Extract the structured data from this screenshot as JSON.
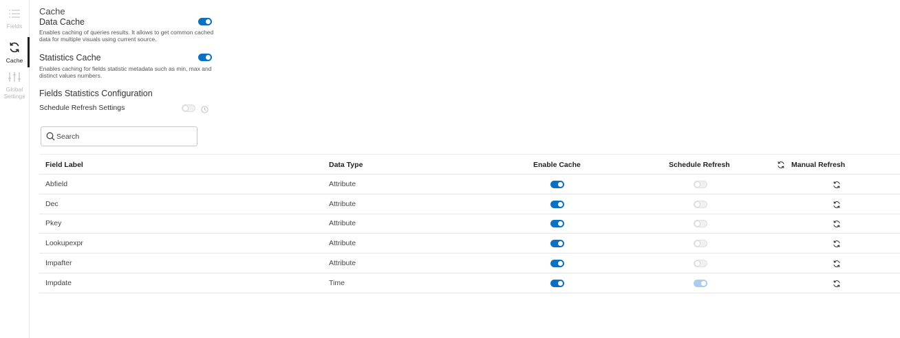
{
  "sidebar": {
    "items": [
      {
        "label": "Fields",
        "icon": "list-icon",
        "active": false
      },
      {
        "label": "Cache",
        "icon": "refresh-icon",
        "active": true
      },
      {
        "label": "Global Settings",
        "label_line1": "Global",
        "label_line2": "Settings",
        "icon": "sliders-icon",
        "active": false
      }
    ]
  },
  "cache": {
    "title": "Cache",
    "data_cache": {
      "title": "Data Cache",
      "description": "Enables caching of queries results. It allows to get common cached data for multiple visuals using current source.",
      "enabled": true
    },
    "statistics_cache": {
      "title": "Statistics Cache",
      "description": "Enables caching for fields statistic metadata such as min, max and distinct values numbers.",
      "enabled": true
    },
    "fields_stats": {
      "title": "Fields Statistics Configuration",
      "schedule_label": "Schedule Refresh Settings",
      "schedule_enabled": false
    }
  },
  "search": {
    "placeholder": "Search",
    "value": ""
  },
  "table": {
    "columns": {
      "field_label": "Field Label",
      "data_type": "Data Type",
      "enable_cache": "Enable Cache",
      "schedule_refresh": "Schedule Refresh",
      "manual_refresh": "Manual Refresh"
    },
    "rows": [
      {
        "label": "Abfield",
        "type": "Attribute",
        "enable_cache": true,
        "schedule_refresh": false
      },
      {
        "label": "Dec",
        "type": "Attribute",
        "enable_cache": true,
        "schedule_refresh": false
      },
      {
        "label": "Pkey",
        "type": "Attribute",
        "enable_cache": true,
        "schedule_refresh": false
      },
      {
        "label": "Lookupexpr",
        "type": "Attribute",
        "enable_cache": true,
        "schedule_refresh": false
      },
      {
        "label": "Impafter",
        "type": "Attribute",
        "enable_cache": true,
        "schedule_refresh": false
      },
      {
        "label": "Impdate",
        "type": "Time",
        "enable_cache": true,
        "schedule_refresh": true
      }
    ]
  },
  "colors": {
    "accent": "#0c6fc0",
    "accent_light": "#a9cdef",
    "inactive": "#b8b8b8"
  }
}
